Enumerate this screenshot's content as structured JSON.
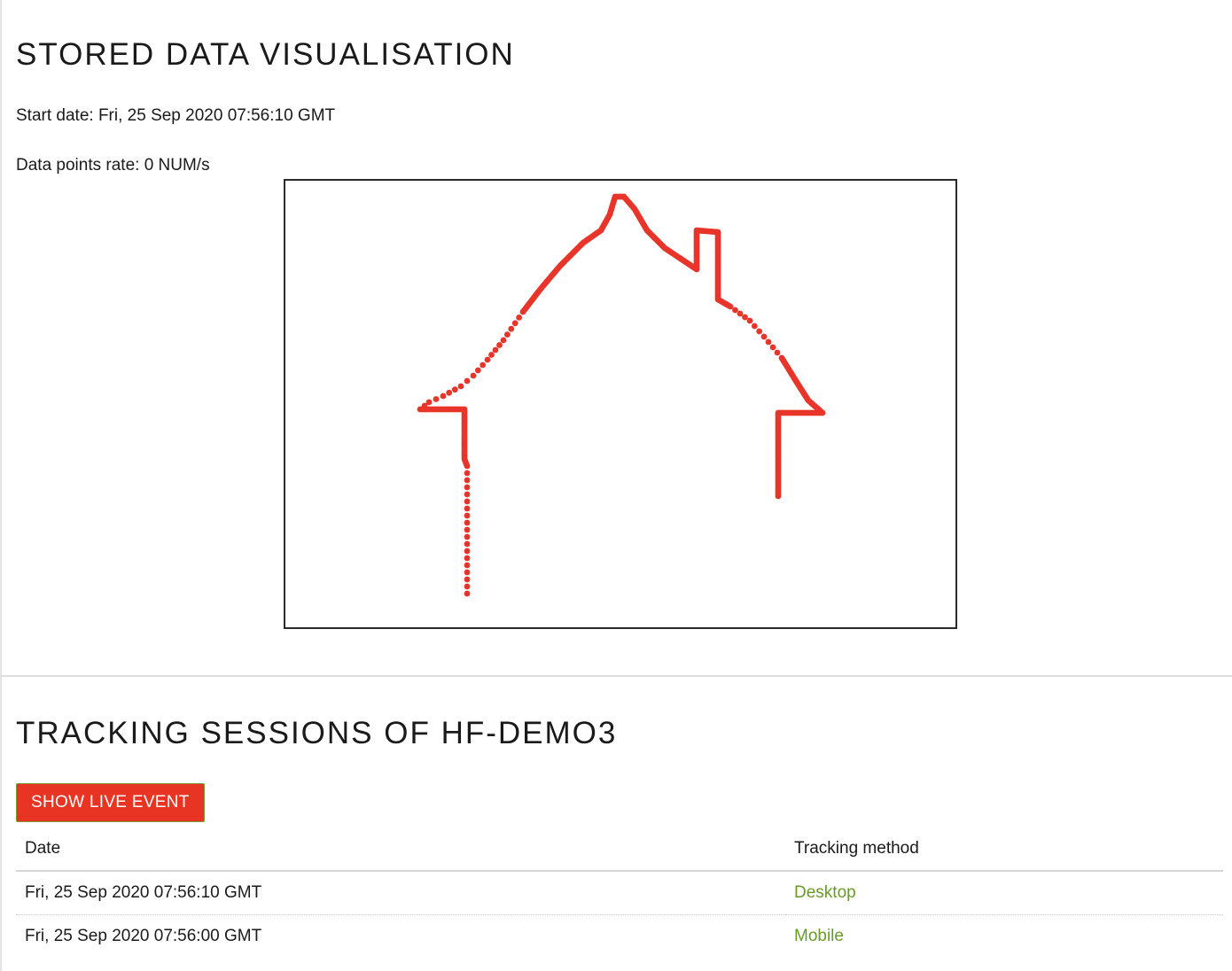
{
  "stored": {
    "title": "STORED DATA VISUALISATION",
    "start_date": "Start date: Fri, 25 Sep 2020 07:56:10 GMT",
    "rate": "Data points rate: 0 NUM/s"
  },
  "tracking": {
    "title": "TRACKING SESSIONS OF HF-DEMO3",
    "live_button": "SHOW LIVE EVENT",
    "columns": {
      "date": "Date",
      "method": "Tracking method"
    },
    "sessions": [
      {
        "date": "Fri, 25 Sep 2020 07:56:10 GMT",
        "method": "Desktop"
      },
      {
        "date": "Fri, 25 Sep 2020 07:56:00 GMT",
        "method": "Mobile"
      }
    ]
  },
  "colors": {
    "stroke": "#e8352a",
    "button": "#e83423",
    "link": "#6a9a2a"
  }
}
